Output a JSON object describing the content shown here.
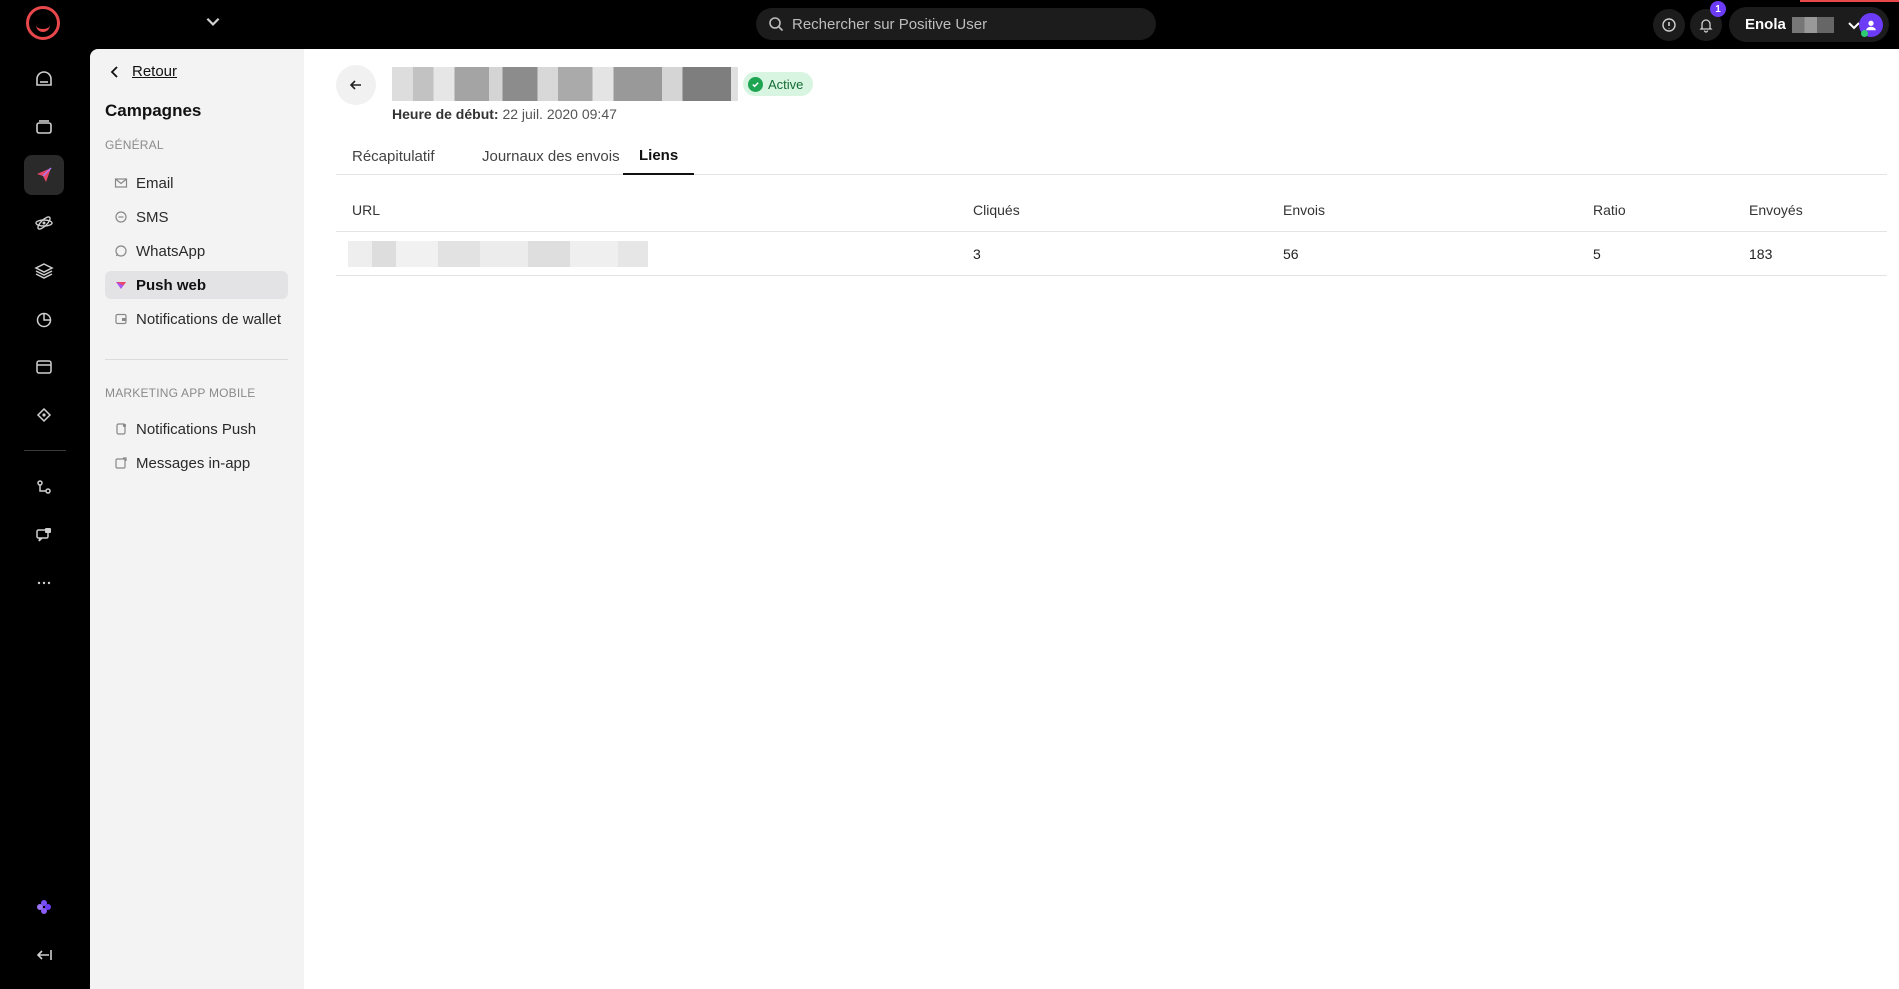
{
  "topbar": {
    "search_placeholder": "Rechercher sur Positive User",
    "notification_count": "1",
    "user_first_name": "Enola"
  },
  "sidebar": {
    "back_label": "Retour",
    "title": "Campagnes",
    "section_general": "GÉNÉRAL",
    "general_items": [
      "Email",
      "SMS",
      "WhatsApp",
      "Push web",
      "Notifications de wallet"
    ],
    "active_item": "Push web",
    "section_mobile": "MARKETING APP MOBILE",
    "mobile_items": [
      "Notifications Push",
      "Messages in-app"
    ]
  },
  "campaign": {
    "status": "Active",
    "start_label": "Heure de début:",
    "start_value": "22 juil. 2020 09:47"
  },
  "tabs": [
    "Récapitulatif",
    "Journaux des envois",
    "Liens"
  ],
  "active_tab": "Liens",
  "table": {
    "columns": [
      "URL",
      "Cliqués",
      "Envois",
      "Ratio",
      "Envoyés"
    ],
    "rows": [
      {
        "url": "",
        "clicked": "3",
        "sends": "56",
        "ratio": "5",
        "sent": "183"
      }
    ]
  },
  "colors": {
    "accent": "#6c3bf5",
    "brand": "#e8474c",
    "status_active_bg": "#d8f5e2",
    "status_active_fg": "#146c34"
  }
}
